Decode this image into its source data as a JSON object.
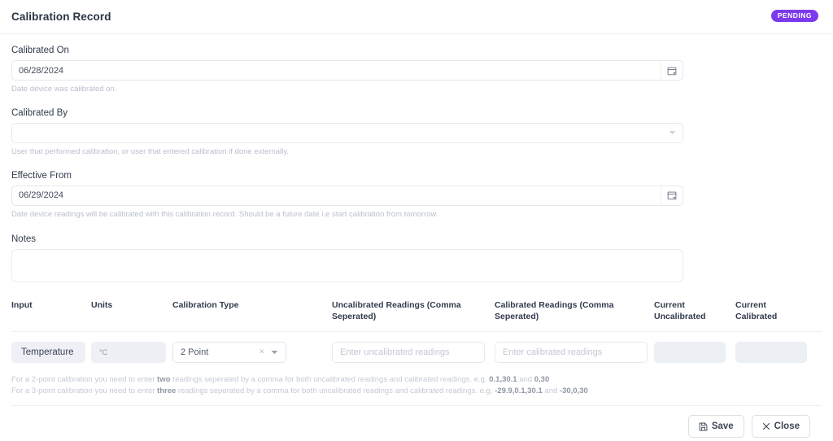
{
  "header": {
    "title": "Calibration Record",
    "status_badge": "PENDING",
    "badge_color": "#7c3aed"
  },
  "form": {
    "calibrated_on": {
      "label": "Calibrated On",
      "value": "06/28/2024",
      "help": "Date device was calibrated on.",
      "icon": "calendar-icon"
    },
    "calibrated_by": {
      "label": "Calibrated By",
      "value": "",
      "placeholder": "",
      "help": "User that performed calibration, or user that entered calibration if done externally.",
      "icon": "chevron-down-icon"
    },
    "effective_from": {
      "label": "Effective From",
      "value": "06/29/2024",
      "help": "Date device readings will be calibrated with this calibration record. Should be a future date i.e start calibration from tomorrow.",
      "icon": "calendar-icon"
    },
    "notes": {
      "label": "Notes",
      "value": "",
      "placeholder": ""
    }
  },
  "table": {
    "headers": [
      "Input",
      "Units",
      "Calibration Type",
      "Uncalibrated Readings (Comma Seperated)",
      "Calibrated Readings (Comma Seperated)",
      "Current Uncalibrated",
      "Current Calibrated"
    ],
    "rows": [
      {
        "input": "Temperature",
        "units": "°C",
        "calibration_type": "2 Point",
        "calibration_type_clear": "×",
        "uncalibrated_value": "",
        "uncalibrated_placeholder": "Enter uncalibrated readings",
        "calibrated_value": "",
        "calibrated_placeholder": "Enter calibrated readings",
        "current_uncalibrated": "",
        "current_calibrated": ""
      }
    ]
  },
  "footnotes": [
    {
      "prefix": "For a 2-point calibration you need to enter ",
      "strong": "two",
      "middle": " readings seperated by a comma for both uncalibrated readings and calibrated readings. e.g. ",
      "example_a": "0.1,30.1",
      "conj": " and ",
      "example_b": "0,30"
    },
    {
      "prefix": "For a 3-point calibration you need to enter ",
      "strong": "three",
      "middle": " readings seperated by a comma for both uncalibrated readings and calibrated readings. e.g. ",
      "example_a": "-29.9,0.1,30.1",
      "conj": " and ",
      "example_b": "-30,0,30"
    }
  ],
  "footer": {
    "save_label": "Save",
    "save_icon": "save-icon",
    "close_label": "Close",
    "close_icon": "close-icon"
  }
}
